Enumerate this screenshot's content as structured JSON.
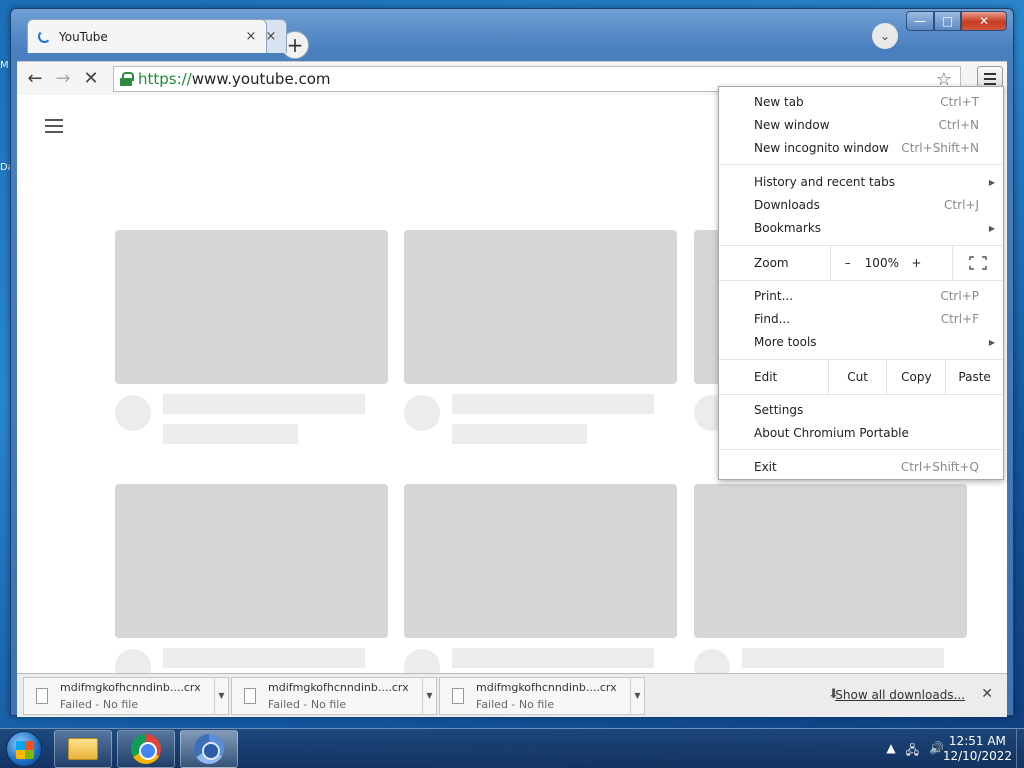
{
  "window": {
    "caption": {
      "minimize": "—",
      "maximize": "□",
      "close": "✕"
    }
  },
  "tabs": [
    {
      "title": "YouTube",
      "close": "×",
      "loading": true
    }
  ],
  "background_tab": {
    "close": "×"
  },
  "newtab_label": "+",
  "toolbar": {
    "back_icon": "←",
    "forward_icon": "→",
    "stop_icon": "✕",
    "url_scheme": "https://",
    "url_host": "www.youtube.com",
    "star_icon": "☆"
  },
  "menu": {
    "group1": [
      {
        "label": "New tab",
        "shortcut": "Ctrl+T"
      },
      {
        "label": "New window",
        "shortcut": "Ctrl+N"
      },
      {
        "label": "New incognito window",
        "shortcut": "Ctrl+Shift+N"
      }
    ],
    "group2": [
      {
        "label": "History and recent tabs",
        "shortcut": "",
        "submenu": true
      },
      {
        "label": "Downloads",
        "shortcut": "Ctrl+J"
      },
      {
        "label": "Bookmarks",
        "shortcut": "",
        "submenu": true
      }
    ],
    "zoom": {
      "label": "Zoom",
      "minus": "–",
      "value": "100%",
      "plus": "+",
      "fullscreen_icon": "fullscreen-icon"
    },
    "group3": [
      {
        "label": "Print...",
        "shortcut": "Ctrl+P"
      },
      {
        "label": "Find...",
        "shortcut": "Ctrl+F"
      },
      {
        "label": "More tools",
        "shortcut": "",
        "submenu": true
      }
    ],
    "edit": {
      "label": "Edit",
      "cut": "Cut",
      "copy": "Copy",
      "paste": "Paste"
    },
    "group4": [
      {
        "label": "Settings",
        "shortcut": ""
      },
      {
        "label": "About Chromium Portable",
        "shortcut": ""
      }
    ],
    "exit": {
      "label": "Exit",
      "shortcut": "Ctrl+Shift+Q"
    },
    "arrow": "▶"
  },
  "downloads": {
    "items": [
      {
        "filename": "mdifmgkofhcnndinb....crx",
        "status": "Failed - No file"
      },
      {
        "filename": "mdifmgkofhcnndinb....crx",
        "status": "Failed - No file"
      },
      {
        "filename": "mdifmgkofhcnndinb....crx",
        "status": "Failed - No file"
      }
    ],
    "dropdown_icon": "▼",
    "show_all": "Show all downloads...",
    "show_all_icon": "⬇",
    "close": "✕"
  },
  "taskbar": {
    "tray_icons": [
      "▲",
      "🖧",
      "🔊"
    ],
    "time": "12:51 AM",
    "date": "12/10/2022"
  }
}
